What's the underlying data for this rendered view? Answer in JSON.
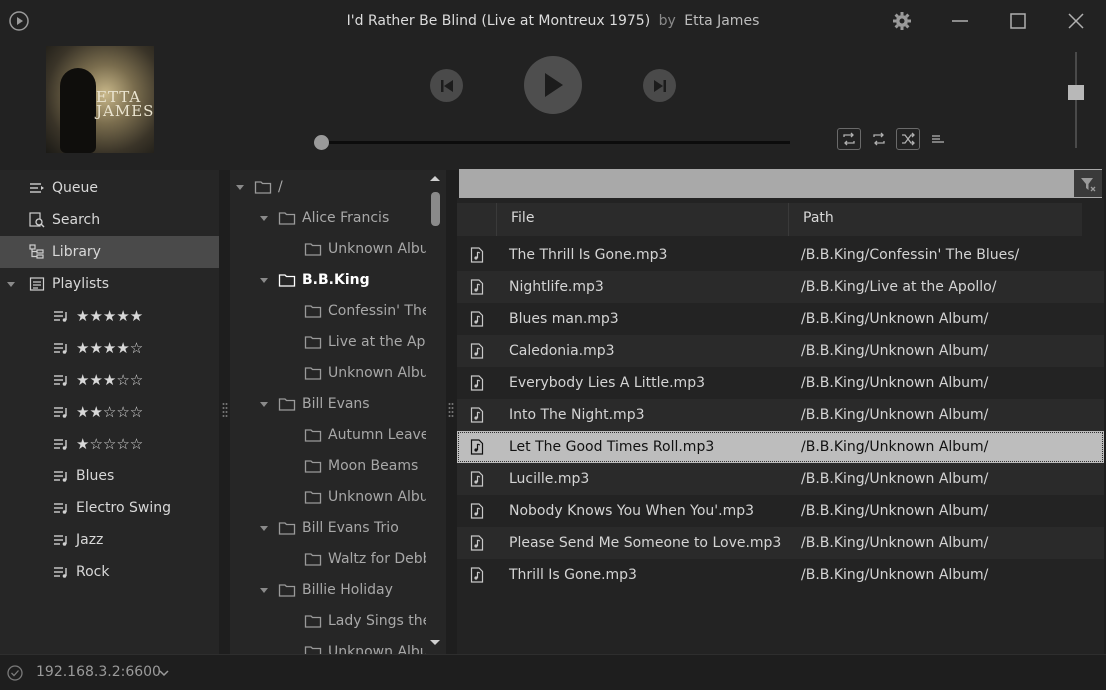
{
  "title": {
    "song": "I'd Rather Be Blind (Live at Montreux 1975)",
    "by": "by",
    "artist": "Etta James"
  },
  "album_art_text": "ETTA\nJAMES",
  "nav": {
    "items": [
      {
        "label": "Queue",
        "icon": "queue-icon"
      },
      {
        "label": "Search",
        "icon": "search-icon"
      },
      {
        "label": "Library",
        "icon": "library-icon"
      },
      {
        "label": "Playlists",
        "icon": "playlists-icon"
      }
    ],
    "playlists": [
      {
        "label": "★★★★★",
        "rating": 5
      },
      {
        "label": "★★★★☆",
        "rating": 4
      },
      {
        "label": "★★★☆☆",
        "rating": 3
      },
      {
        "label": "★★☆☆☆",
        "rating": 2
      },
      {
        "label": "★☆☆☆☆",
        "rating": 1
      },
      {
        "label": "Blues"
      },
      {
        "label": "Electro Swing"
      },
      {
        "label": "Jazz"
      },
      {
        "label": "Rock"
      }
    ]
  },
  "tree": [
    {
      "label": "/",
      "level": 0,
      "expanded": true
    },
    {
      "label": "Alice Francis",
      "level": 1,
      "expanded": true
    },
    {
      "label": "Unknown Album",
      "level": 2
    },
    {
      "label": "B.B.King",
      "level": 1,
      "expanded": true,
      "bold": true
    },
    {
      "label": "Confessin' The Blues",
      "level": 2
    },
    {
      "label": "Live at the Apollo",
      "level": 2
    },
    {
      "label": "Unknown Album",
      "level": 2
    },
    {
      "label": "Bill Evans",
      "level": 1,
      "expanded": true
    },
    {
      "label": "Autumn Leaves",
      "level": 2
    },
    {
      "label": "Moon Beams",
      "level": 2
    },
    {
      "label": "Unknown Album",
      "level": 2
    },
    {
      "label": "Bill Evans Trio",
      "level": 1,
      "expanded": true
    },
    {
      "label": "Waltz for Debby",
      "level": 2
    },
    {
      "label": "Billie Holiday",
      "level": 1,
      "expanded": true
    },
    {
      "label": "Lady Sings the Blues",
      "level": 2
    },
    {
      "label": "Unknown Album",
      "level": 2
    }
  ],
  "list": {
    "columns": [
      "File",
      "Path"
    ],
    "rows": [
      {
        "file": "The Thrill Is Gone.mp3",
        "path": "/B.B.King/Confessin' The Blues/"
      },
      {
        "file": "Nightlife.mp3",
        "path": "/B.B.King/Live at the Apollo/"
      },
      {
        "file": "Blues man.mp3",
        "path": "/B.B.King/Unknown Album/"
      },
      {
        "file": "Caledonia.mp3",
        "path": "/B.B.King/Unknown Album/"
      },
      {
        "file": "Everybody Lies A Little.mp3",
        "path": "/B.B.King/Unknown Album/"
      },
      {
        "file": "Into The Night.mp3",
        "path": "/B.B.King/Unknown Album/"
      },
      {
        "file": "Let The Good Times Roll.mp3",
        "path": "/B.B.King/Unknown Album/",
        "selected": true
      },
      {
        "file": "Lucille.mp3",
        "path": "/B.B.King/Unknown Album/"
      },
      {
        "file": "Nobody Knows You When You'.mp3",
        "path": "/B.B.King/Unknown Album/"
      },
      {
        "file": "Please Send Me Someone to Love.mp3",
        "path": "/B.B.King/Unknown Album/"
      },
      {
        "file": "Thrill Is Gone.mp3",
        "path": "/B.B.King/Unknown Album/"
      }
    ]
  },
  "player": {
    "progress": 0.0,
    "volume": 0.58
  },
  "status": {
    "server": "192.168.3.2:6600"
  }
}
